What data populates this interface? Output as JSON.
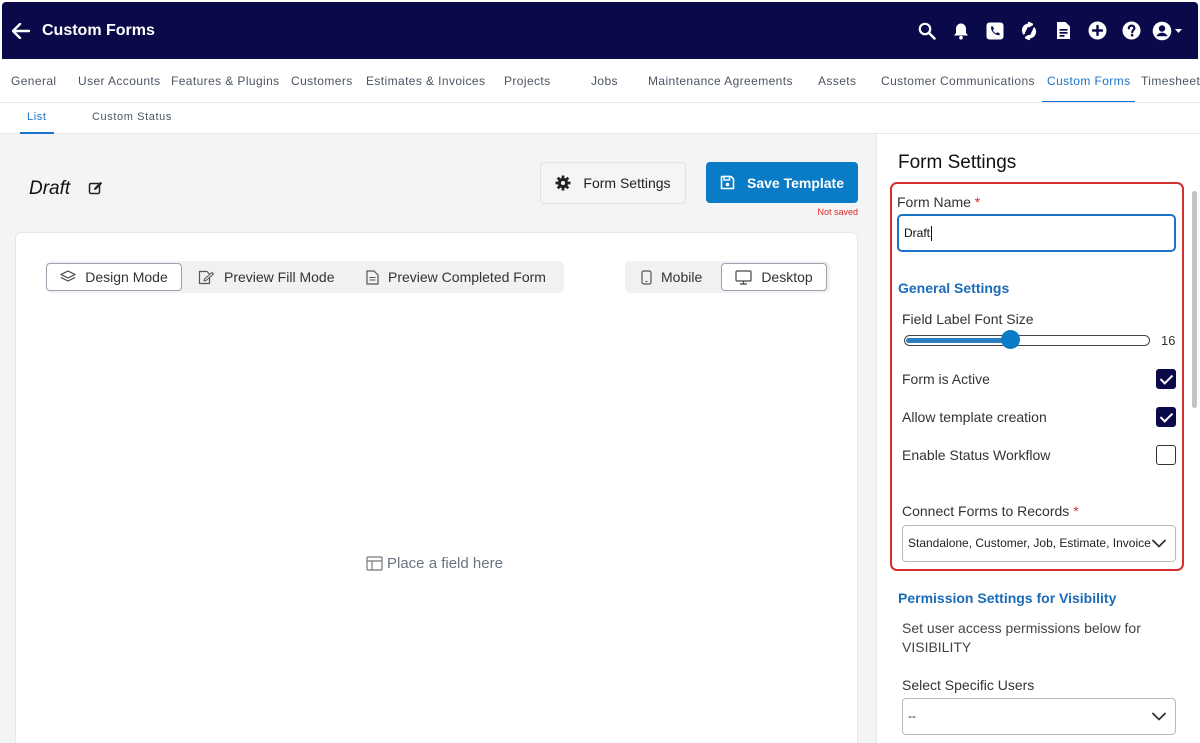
{
  "header": {
    "title": "Custom Forms",
    "icons": [
      "back-arrow-icon",
      "search-icon",
      "bell-icon",
      "phone-icon",
      "sync-icon",
      "document-icon",
      "plus-circle-icon",
      "help-icon",
      "user-account-icon"
    ],
    "bg_color": "#0a0a4a"
  },
  "nav": {
    "tabs": [
      {
        "label": "General"
      },
      {
        "label": "User Accounts"
      },
      {
        "label": "Features & Plugins"
      },
      {
        "label": "Customers"
      },
      {
        "label": "Estimates & Invoices"
      },
      {
        "label": "Projects"
      },
      {
        "label": "Jobs"
      },
      {
        "label": "Maintenance Agreements"
      },
      {
        "label": "Assets"
      },
      {
        "label": "Customer Communications"
      },
      {
        "label": "Custom Forms"
      },
      {
        "label": "Timesheet"
      }
    ],
    "active": "Custom Forms"
  },
  "subnav": {
    "tabs": [
      {
        "label": "List"
      },
      {
        "label": "Custom Status"
      }
    ],
    "active": "List"
  },
  "editor": {
    "form_title": "Draft",
    "form_settings_label": "Form Settings",
    "save_label": "Save Template",
    "save_status": "Not saved",
    "modes": [
      {
        "label": "Design Mode"
      },
      {
        "label": "Preview Fill Mode"
      },
      {
        "label": "Preview Completed Form"
      }
    ],
    "active_mode": "Design Mode",
    "devices": [
      {
        "label": "Mobile"
      },
      {
        "label": "Desktop"
      }
    ],
    "active_device": "Desktop",
    "placeholder": "Place a field here"
  },
  "settings": {
    "title": "Form Settings",
    "form_name_label": "Form Name",
    "required_marker": "*",
    "form_name_value": "Draft",
    "general_heading": "General Settings",
    "font_size_label": "Field Label Font Size",
    "font_size_value": "16",
    "font_size_fraction": 0.43,
    "form_active_label": "Form is Active",
    "form_active": true,
    "template_label": "Allow template creation",
    "template_allowed": true,
    "workflow_label": "Enable Status Workflow",
    "workflow_enabled": false,
    "connect_label": "Connect Forms to Records",
    "connect_value": "Standalone, Customer, Job, Estimate, Invoice",
    "permission_heading": "Permission Settings for Visibility",
    "permission_desc": "Set user access permissions below for VISIBILITY",
    "users_label": "Select Specific Users",
    "users_value": "--"
  },
  "colors": {
    "accent": "#1a73c9",
    "primary_button": "#0a7bc6",
    "highlight_border": "#d32f2f",
    "error_text": "#dc2626"
  }
}
